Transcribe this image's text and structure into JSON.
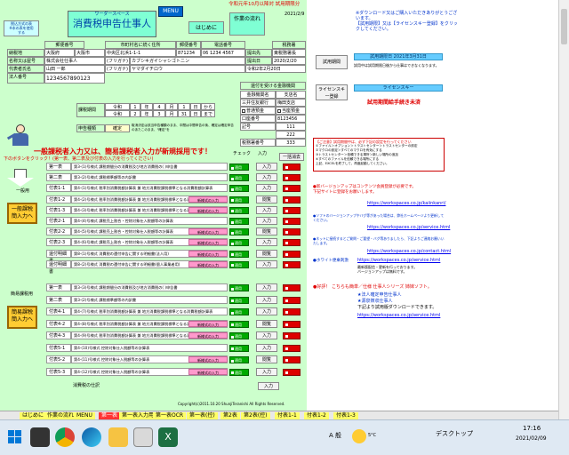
{
  "header": {
    "ware_label": "ワーダースペース",
    "title": "消費税申告仕事人",
    "menu_btn": "MENU",
    "flow_btn": "作業の流れ",
    "start_btn": "はじめに",
    "trial_note": "令和元年10月以降対 試用期限分",
    "date": "2021/2/9",
    "left_note1": "税込方式の表",
    "left_note2": "※本の表を使用",
    "left_note3": "する"
  },
  "company": {
    "col_tax_office": "郵便番号",
    "col_city": "市町村名に続く住所",
    "col_postal": "郵便番号",
    "col_phone": "電話番号",
    "col_office": "税務署",
    "row1_label": "納税地",
    "pref": "大阪府",
    "city": "大阪市",
    "address": "中央区北浜1-1-1",
    "postal": "871234",
    "phone": "06 1234 4567",
    "office_label": "提出先",
    "office": "東税務署長",
    "name_label": "名称又は屋号",
    "name": "株式会社仕事人",
    "kana_label": "(フリガナ)",
    "kana": "カブシキガイシャシゴトニン",
    "submit_label": "提出日",
    "submit_date": "2020/2/20",
    "rep_label": "代表者氏名",
    "rep": "山田 一郎",
    "rep_kana": "ヤマダイチロウ",
    "date_label": "令和2年2月20日",
    "corp_label": "法人番号",
    "corp_no": "1234567890123"
  },
  "period": {
    "label": "課税期間",
    "from_era": "令和",
    "from_y": "1",
    "from_m": "4",
    "from_d": "1",
    "to_era": "令和",
    "to_y": "2",
    "to_m": "3",
    "to_d": "31",
    "kara": "から",
    "made": "まで",
    "y": "年",
    "m": "月",
    "d": "日",
    "kind_label": "申告種類",
    "kind": "確定",
    "kind_note": "取消決定は該当申告種類のまま、中間は中間申告の後、確定は確定申告のあたこのまま、\"確定\"を"
  },
  "bank": {
    "title": "還付を受ける金融機関",
    "bank_label": "金融機関名",
    "branch_label": "支店名",
    "bank": "三井住友銀行",
    "branch": "梅田支店",
    "type_label1": "普通預金",
    "type_label2": "当座預金",
    "acct_label": "口座番号",
    "acct": "8123456",
    "yucho_label": "記号",
    "yucho_no": "111",
    "yucho_no2": "222",
    "tax_acct": "税務署番号",
    "tax_no": "333"
  },
  "notice": {
    "main": "一般課税者入力又は、簡易課税者入力が新規採用です！",
    "sub": "下のボタンをクリック！(第一表、第二表及び付表の入力を行ってください)",
    "general": "一般用",
    "general_btn": "一般課税\n簡入力へ",
    "simple": "簡易課税用",
    "simple_btn": "簡易課税\n簡入力へ",
    "col_input": "入力",
    "col_check": "チェック"
  },
  "general_rows": [
    {
      "name": "第一表",
      "desc": "第3-(1)号様式 課税期間分の消費税及び地方消費税の( )申告書"
    },
    {
      "name": "第二表",
      "desc": "第3-(2)号様式 課税標準額等の内訳書"
    },
    {
      "name": "付表1-1",
      "desc": "第4-(1)号様式 税率別消費税額計算表 兼 地方消費税課税標準となる消費税額計算表"
    },
    {
      "name": "付表1-2",
      "desc": "第4-(2)号様式 税率別消費税額計算表 兼 地方消費税課税標準となる消費税額計算表"
    },
    {
      "name": "付表1-3",
      "desc": "第4-(3)号様式 税率別消費税額計算表 兼 地方消費税課税標準となる消費税額計算表"
    },
    {
      "name": "付表2-1",
      "desc": "第4-(4)号様式 課税売上割合・控除対象仕入税額等の計算表"
    },
    {
      "name": "付表2-2",
      "desc": "第4-(5)号様式 課税売上割合・控除対象仕入税額等の計算表"
    },
    {
      "name": "付表2-3",
      "desc": "第4-(6)号様式 課税売上割合・控除対象仕入税額等の計算表"
    },
    {
      "name": "還付明細書",
      "desc": "第8-(1)号様式 消費税の還付申告に関する明細書(法人用)"
    },
    {
      "name": "還付明細書",
      "desc": "第8-(2)号様式 消費税の還付申告に関する明細書(個人事業者用)"
    }
  ],
  "simple_rows": [
    {
      "name": "第一表",
      "desc": "第3-(3)号様式 課税期間分の消費税及び地方消費税の( )申告書"
    },
    {
      "name": "第二表",
      "desc": "第3-(2)号様式 課税標準額等の内訳書"
    },
    {
      "name": "付表4-1",
      "desc": "第4-(7)号様式 税率別消費税額計算表 兼 地方消費税課税標準となる消費税額計算表"
    },
    {
      "name": "付表4-2",
      "desc": "第4-(8)号様式 税率別消費税額計算表 兼 地方消費税課税標準となる消費税額計算表"
    },
    {
      "name": "付表4-3",
      "desc": "第4-(9)号様式 税率別消費税額計算表 兼 地方消費税課税標準となる消費税額計算表"
    },
    {
      "name": "付表5-1",
      "desc": "第4-(10)号様式 控除対象仕入税額等の計算表"
    },
    {
      "name": "付表5-2",
      "desc": "第4-(11)号様式 控除対象仕入税額等の計算表"
    },
    {
      "name": "付表5-3",
      "desc": "第4-(12)号様式 控除対象仕入税額等の計算表"
    }
  ],
  "row_buttons": {
    "apply": "適用",
    "input": "入力",
    "view": "閲覧",
    "new_form": "新様式の入力",
    "clear": "一括消去"
  },
  "footer_note": "消費税の仕訳",
  "copyright": "Copyright(c)2011.10.20 ShunjiTeranishi All Rights Reserved.",
  "right": {
    "top_note": "※ダウンロード又はご購入いただきありがとうございます。\n【試用期限】又は【ライセンスキー登録】をクリックしてください。",
    "trial_btn": "試用期間",
    "trial_date": "試用期限日 2021年3月31日",
    "trial_note": "試用中は試用期限日後から仕事はできなくなります。",
    "license_btn": "ライセンスキー登録",
    "license_field": "ライセンスキー",
    "status": "試用期間給手続き未済",
    "tips_title": "【ご注意】試用期間中は、必ず下記の設定を行ってください",
    "tips": [
      "①ファイル＞オプション＞トラストセンター＞トラストセンターの設定",
      "②マクロの設定＞すべてのマクロを有効にする",
      "③トラストセンター＞信頼できる場所＞新しい場所の追加",
      "④すべてのファイルを信頼できる場所にする",
      "上記、EXCELを終了して、再度起動してください。"
    ],
    "update_note": "●新バージョンアップはコンテンツ会員登録が必要です。\n下記サイトに登録をお願いします。",
    "url1": "https://workspaces.co.jp/kaiinkanri/",
    "soft_note": "●ソフトのバージョンアップやバグ等があった場合は、弊社ホームページより更新してください。",
    "url2": "https://workspaces.co.jp/service.html",
    "contact_note": "●ネットに接続するとご質問・ご要望・バグ等ありましたら、下記よりご連絡お願いいたします。",
    "url3": "https://workspaces.co.jp/contact.html",
    "sample_label": "●ホワイト便乗刺激",
    "url4": "https://workspaces.co.jp/service.html",
    "sample_note": "最新版配信・更新を行っております。\nバージョンアップは無料です。",
    "series_title": "●好評！ こちらも簡単／仕様 仕事人シリーズ 姉妹ソフト。",
    "series1": "★法人確定申告仕事人",
    "series2": "★源泉徴収仕事人",
    "series_note": "下記より試用版ダウンロードできます。",
    "url5": "https://workspaces.co.jp/service.html"
  },
  "sheet_tabs": [
    "はじめに",
    "作業の流れ",
    "MENU",
    "第一表",
    "第一表入力用",
    "第一表OCR",
    "第一表(控)",
    "第2表",
    "第2表(控)",
    "付表1-1",
    "付表1-2",
    "付表1-3"
  ],
  "taskbar": {
    "ime": "A 般",
    "weather": "5°C",
    "desktop": "デスクトップ",
    "time": "17:16",
    "date": "2021/02/09"
  }
}
